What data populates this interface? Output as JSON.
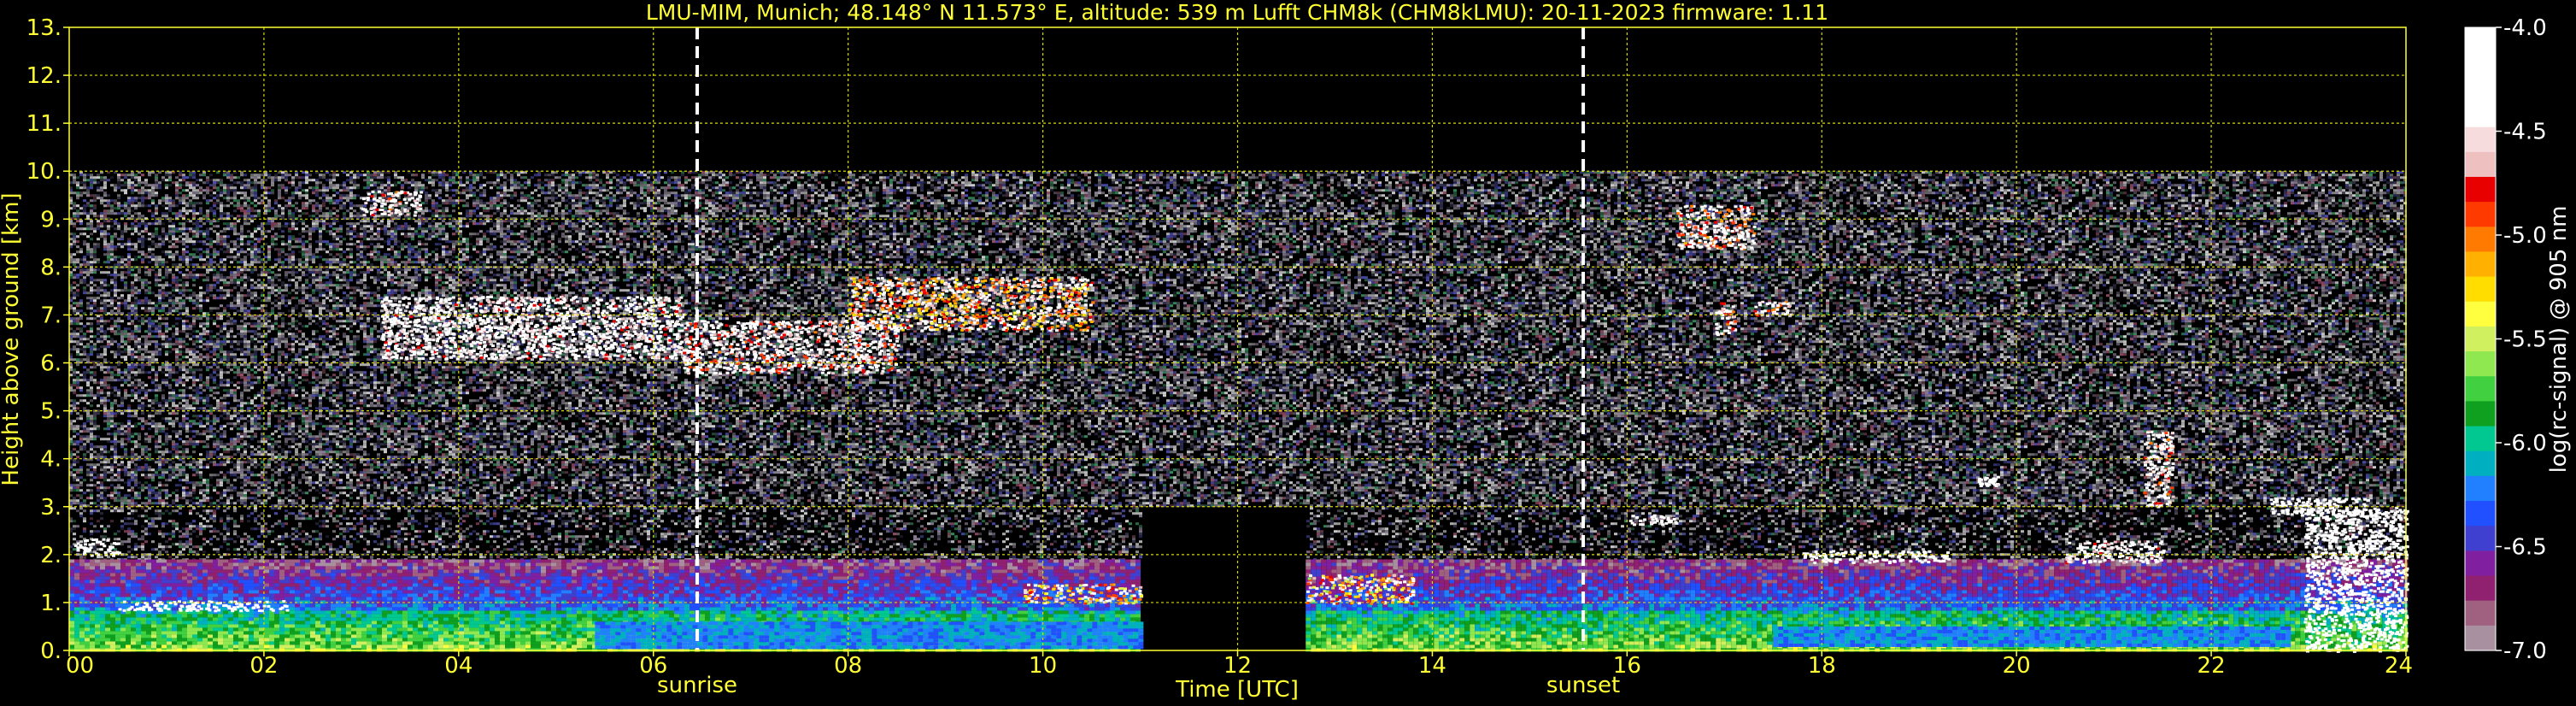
{
  "chart_data": {
    "type": "heatmap",
    "title": "LMU-MIM, Munich; 48.148° N 11.573° E, altitude: 539 m    Lufft CHM8k (CHM8kLMU): 20-11-2023    firmware: 1.11",
    "xlabel": "Time [UTC]",
    "ylabel": "Height above ground [km]",
    "xlim": [
      0,
      24
    ],
    "ylim": [
      0,
      13
    ],
    "x_ticks": [
      "00",
      "02",
      "04",
      "06",
      "08",
      "10",
      "12",
      "14",
      "16",
      "18",
      "20",
      "22",
      "24"
    ],
    "y_ticks": [
      "0.",
      "1.",
      "2.",
      "3.",
      "4.",
      "5.",
      "6.",
      "7.",
      "8.",
      "9.",
      "10.",
      "11.",
      "12.",
      "13."
    ],
    "grid": true,
    "data_ceiling_km": 10,
    "markers": [
      {
        "label": "sunrise",
        "x": 6.45
      },
      {
        "label": "sunset",
        "x": 15.55
      }
    ],
    "gaps": [
      {
        "from": 11.0,
        "to": 12.7
      }
    ],
    "colorbar": {
      "label": "log(rc-signal) @ 905 nm",
      "min": -7.0,
      "max": -4.0,
      "ticks": [
        "-4.0",
        "-4.5",
        "-5.0",
        "-5.5",
        "-6.0",
        "-6.5",
        "-7.0"
      ],
      "colors": [
        "#ffffff",
        "#ffffff",
        "#ffffff",
        "#ffffff",
        "#f6dcdc",
        "#eec0c0",
        "#e80000",
        "#ff3a00",
        "#ff7a00",
        "#ffb000",
        "#ffdd00",
        "#ffff40",
        "#d0f060",
        "#90e850",
        "#40d040",
        "#10a020",
        "#00c890",
        "#00b0c0",
        "#2080ff",
        "#2050ff",
        "#4040d0",
        "#8020a0",
        "#902070",
        "#a06080",
        "#a890a0"
      ]
    },
    "features": [
      {
        "kind": "boundary_layer",
        "x_from": 0,
        "x_to": 11.0,
        "y_from": 0.0,
        "y_to": 1.9,
        "level": -6.3
      },
      {
        "kind": "boundary_layer",
        "x_from": 12.7,
        "x_to": 24,
        "y_from": 0.0,
        "y_to": 1.9,
        "level": -6.3
      },
      {
        "kind": "low_cloud",
        "x_from": 0.5,
        "x_to": 2.25,
        "y_from": 0.85,
        "y_to": 1.05,
        "level": -4.2
      },
      {
        "kind": "low_cloud",
        "x_from": 0.05,
        "x_to": 0.5,
        "y_from": 2.0,
        "y_to": 2.35,
        "level": -4.3
      },
      {
        "kind": "cirrus",
        "x_from": 3.0,
        "x_to": 3.6,
        "y_from": 9.1,
        "y_to": 9.6,
        "level": -4.8
      },
      {
        "kind": "cirrus",
        "x_from": 3.2,
        "x_to": 6.3,
        "y_from": 6.1,
        "y_to": 7.4,
        "level": -4.6
      },
      {
        "kind": "cirrus",
        "x_from": 6.3,
        "x_to": 8.5,
        "y_from": 5.8,
        "y_to": 6.9,
        "level": -4.8
      },
      {
        "kind": "cirrus",
        "x_from": 8.0,
        "x_to": 10.5,
        "y_from": 6.7,
        "y_to": 7.8,
        "level": -5.2
      },
      {
        "kind": "low_cloud",
        "x_from": 9.8,
        "x_to": 11.0,
        "y_from": 1.0,
        "y_to": 1.4,
        "level": -5.4
      },
      {
        "kind": "low_cloud",
        "x_from": 12.7,
        "x_to": 13.8,
        "y_from": 1.0,
        "y_to": 1.6,
        "level": -5.4
      },
      {
        "kind": "cirrus",
        "x_from": 16.5,
        "x_to": 17.3,
        "y_from": 8.4,
        "y_to": 9.3,
        "level": -4.9
      },
      {
        "kind": "cirrus",
        "x_from": 16.9,
        "x_to": 17.1,
        "y_from": 6.6,
        "y_to": 7.3,
        "level": -4.8
      },
      {
        "kind": "cirrus",
        "x_from": 17.3,
        "x_to": 17.7,
        "y_from": 7.0,
        "y_to": 7.3,
        "level": -5.0
      },
      {
        "kind": "low_cloud",
        "x_from": 16.0,
        "x_to": 16.5,
        "y_from": 2.65,
        "y_to": 2.85,
        "level": -4.3
      },
      {
        "kind": "low_cloud",
        "x_from": 17.8,
        "x_to": 19.3,
        "y_from": 1.85,
        "y_to": 2.1,
        "level": -4.2
      },
      {
        "kind": "low_cloud",
        "x_from": 20.5,
        "x_to": 21.5,
        "y_from": 1.85,
        "y_to": 2.3,
        "level": -4.6
      },
      {
        "kind": "low_cloud",
        "x_from": 19.6,
        "x_to": 19.8,
        "y_from": 3.45,
        "y_to": 3.65,
        "level": -4.3
      },
      {
        "kind": "low_cloud",
        "x_from": 21.3,
        "x_to": 21.6,
        "y_from": 3.0,
        "y_to": 4.6,
        "level": -4.8
      },
      {
        "kind": "low_cloud",
        "x_from": 22.6,
        "x_to": 23.6,
        "y_from": 2.8,
        "y_to": 3.2,
        "level": -4.3
      },
      {
        "kind": "fog",
        "x_from": 22.95,
        "x_to": 24,
        "y_from": 0.0,
        "y_to": 3.0,
        "level": -4.1
      },
      {
        "kind": "aerosol_bright",
        "x_from": 5.4,
        "x_to": 11.0,
        "y_from": 0.1,
        "y_to": 0.6,
        "level": -6.0
      },
      {
        "kind": "aerosol_bright",
        "x_from": 17.5,
        "x_to": 22.8,
        "y_from": 0.1,
        "y_to": 0.5,
        "level": -6.0
      }
    ]
  }
}
